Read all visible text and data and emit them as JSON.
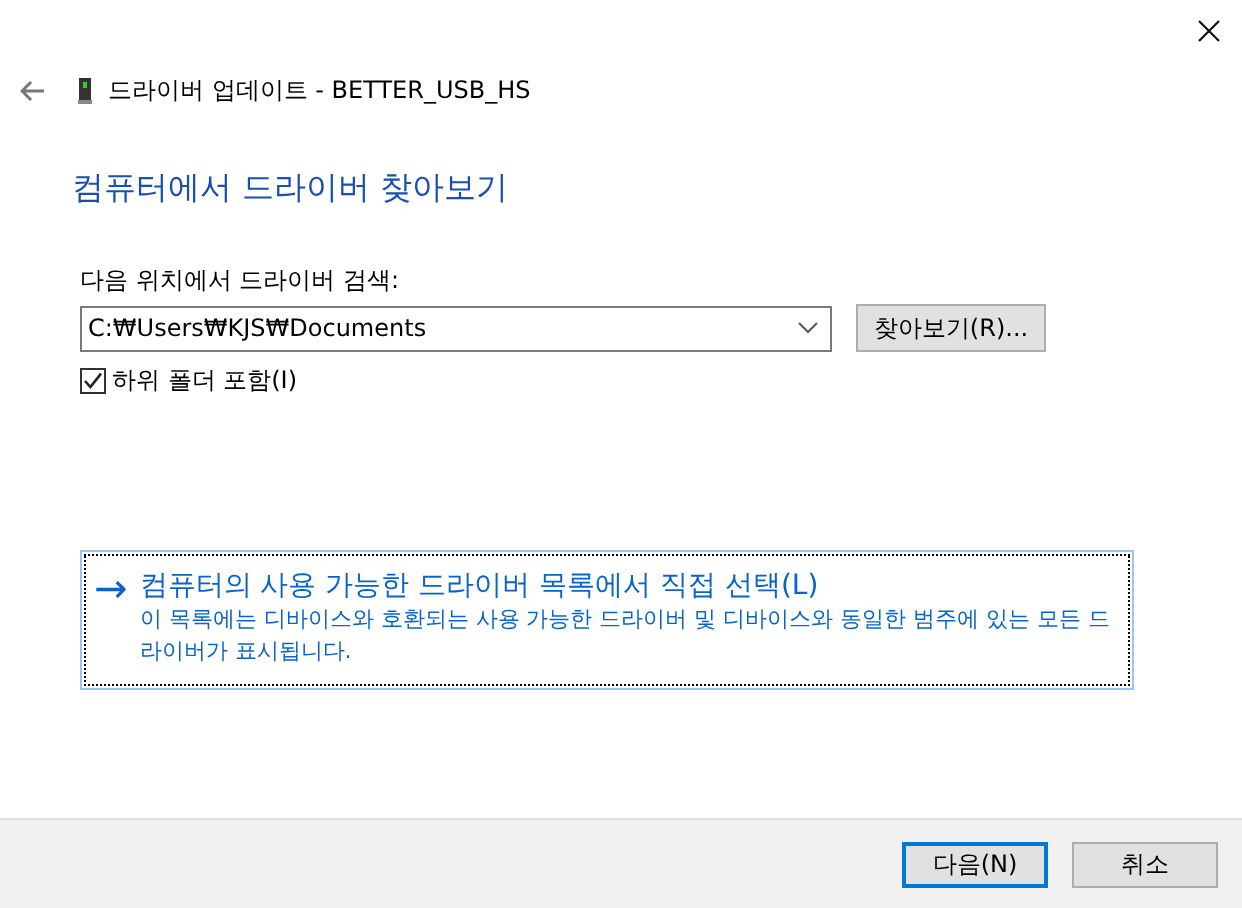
{
  "window": {
    "title": "드라이버 업데이트 - BETTER_USB_HS"
  },
  "heading": "컴퓨터에서 드라이버 찾아보기",
  "search": {
    "label": "다음 위치에서 드라이버 검색:",
    "value": "C:₩Users₩KJS₩Documents",
    "browse_button": "찾아보기(R)..."
  },
  "include_subfolders": {
    "label": "하위 폴더 포함(I)",
    "checked": true
  },
  "pick_option": {
    "arrow": "→",
    "title": "컴퓨터의 사용 가능한 드라이버 목록에서 직접 선택(L)",
    "description": "이 목록에는 디바이스와 호환되는 사용 가능한 드라이버 및 디바이스와 동일한 범주에 있는 모든 드라이버가 표시됩니다."
  },
  "buttons": [
    {
      "label": "다음(N)",
      "selected": true
    },
    {
      "label": "취소",
      "selected": false
    }
  ]
}
